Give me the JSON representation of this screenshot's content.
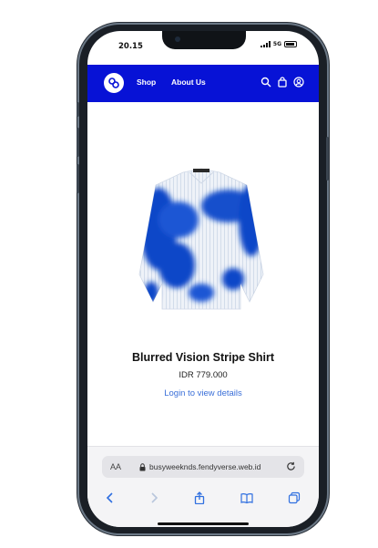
{
  "status_bar": {
    "time": "20.15",
    "network": "5G"
  },
  "navbar": {
    "shop": "Shop",
    "about": "About Us",
    "bg_color": "#0712d6"
  },
  "product": {
    "name": "Blurred Vision Stripe Shirt",
    "price": "IDR 779.000",
    "login_link": "Login to view details"
  },
  "browser": {
    "text_size": "AA",
    "url": "busyweeknds.fendyverse.web.id"
  },
  "icons": [
    "logo-icon",
    "search-icon",
    "bag-icon",
    "account-icon",
    "lock-icon",
    "reload-icon",
    "back-icon",
    "forward-icon",
    "share-icon",
    "bookmarks-icon",
    "tabs-icon"
  ]
}
